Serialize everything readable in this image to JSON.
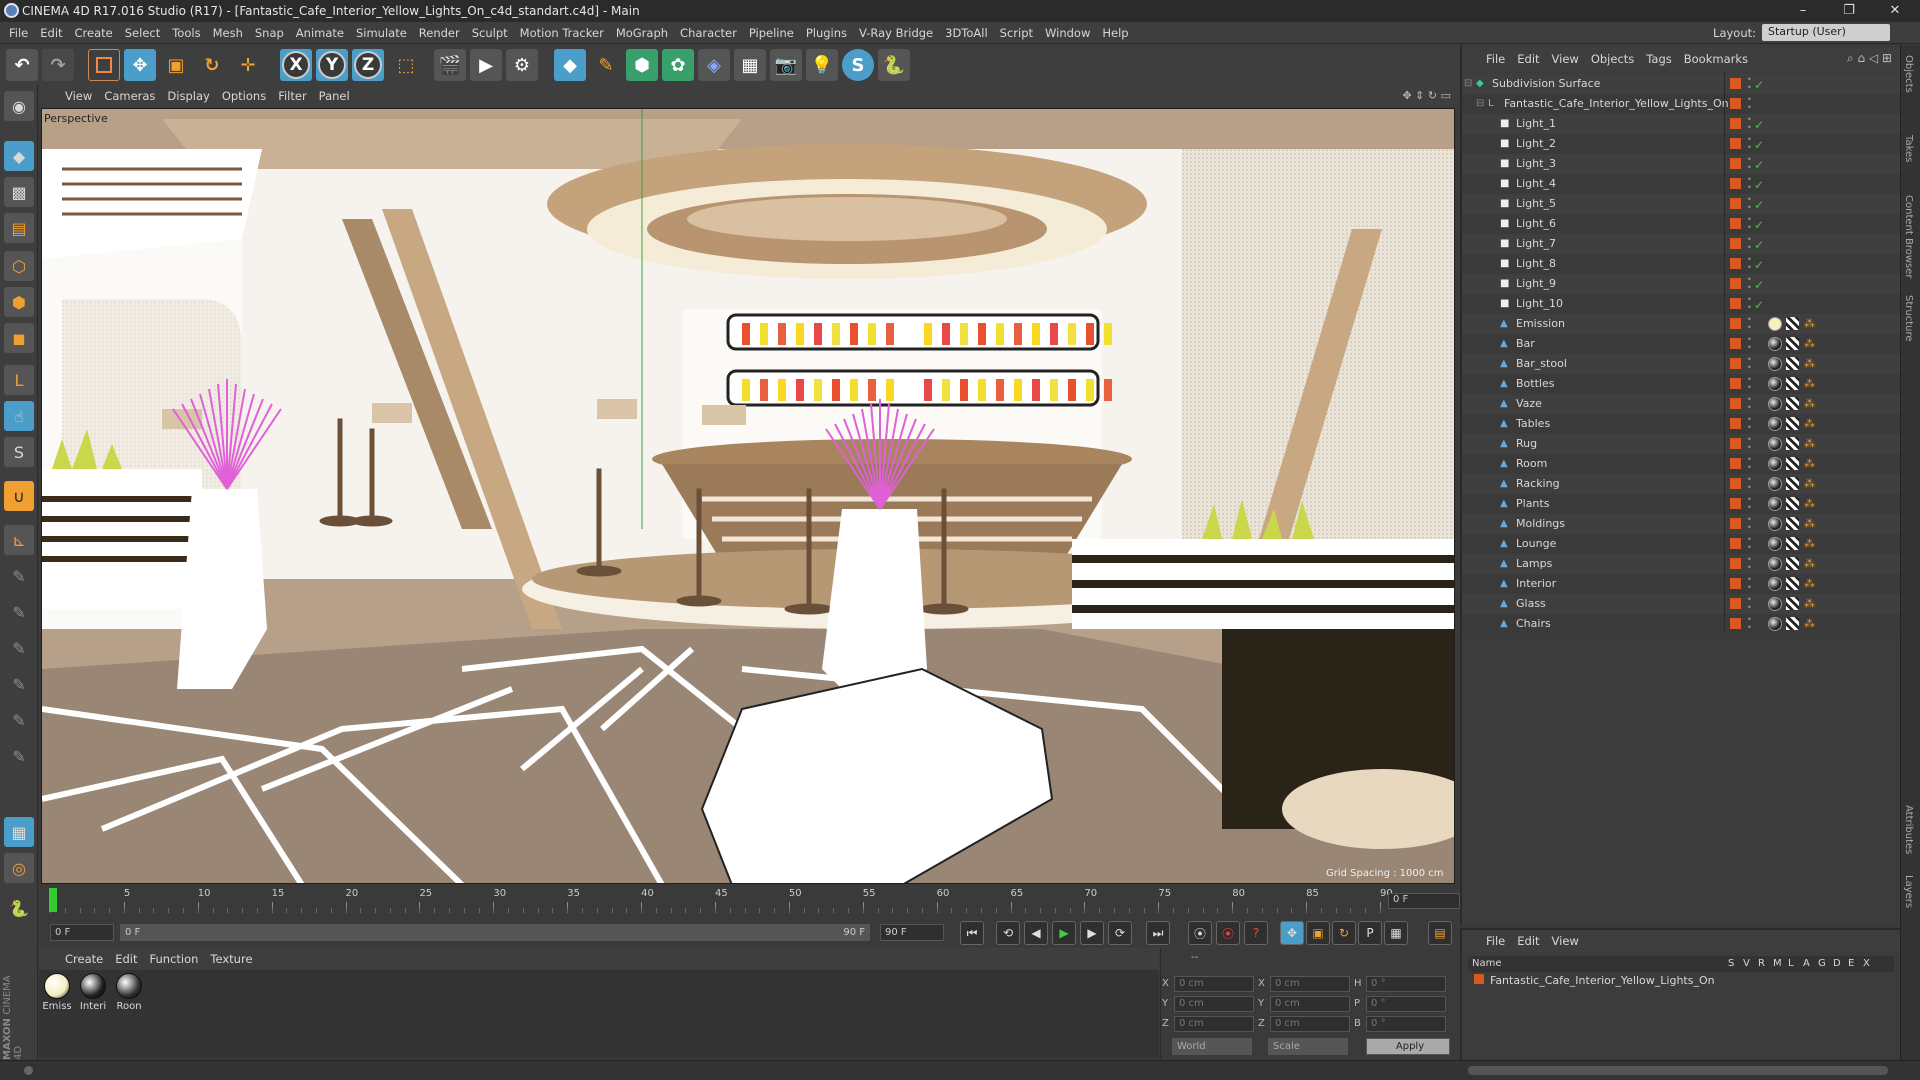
{
  "app": {
    "title": "CINEMA 4D R17.016 Studio (R17) - [Fantastic_Cafe_Interior_Yellow_Lights_On_c4d_standart.c4d] - Main",
    "minimize": "–",
    "maximize": "❐",
    "close": "✕"
  },
  "menu": [
    "File",
    "Edit",
    "Create",
    "Select",
    "Tools",
    "Mesh",
    "Snap",
    "Animate",
    "Simulate",
    "Render",
    "Sculpt",
    "Motion Tracker",
    "MoGraph",
    "Character",
    "Pipeline",
    "Plugins",
    "V-Ray Bridge",
    "3DToAll",
    "Script",
    "Window",
    "Help"
  ],
  "layout": {
    "label": "Layout:",
    "value": "Startup (User)"
  },
  "toolbar": {
    "axis_x": "X",
    "axis_y": "Y",
    "axis_z": "Z"
  },
  "viewport": {
    "menu": [
      "View",
      "Cameras",
      "Display",
      "Options",
      "Filter",
      "Panel"
    ],
    "label": "Perspective",
    "grid": "Grid Spacing : 1000 cm"
  },
  "timeline": {
    "ticks": [
      "0",
      "5",
      "10",
      "15",
      "20",
      "25",
      "30",
      "35",
      "40",
      "45",
      "50",
      "55",
      "60",
      "65",
      "70",
      "75",
      "80",
      "85",
      "90"
    ],
    "current": "0 F",
    "start": "0 F",
    "range_start": "0 F",
    "range_end": "90 F",
    "end": "90 F"
  },
  "materials": {
    "menu": [
      "Create",
      "Edit",
      "Function",
      "Texture"
    ],
    "items": [
      {
        "label": "Emiss",
        "color": "#f4ecc0"
      },
      {
        "label": "Interi",
        "color": "#222222"
      },
      {
        "label": "Roon",
        "color": "#333333"
      }
    ]
  },
  "coords": {
    "rows": [
      {
        "a": "X",
        "av": "0 cm",
        "b": "X",
        "bv": "0 cm",
        "c": "H",
        "cv": "0 °"
      },
      {
        "a": "Y",
        "av": "0 cm",
        "b": "Y",
        "bv": "0 cm",
        "c": "P",
        "cv": "0 °"
      },
      {
        "a": "Z",
        "av": "0 cm",
        "b": "Z",
        "bv": "0 cm",
        "c": "B",
        "cv": "0 °"
      }
    ],
    "mode1": "World",
    "mode2": "Scale",
    "apply": "Apply",
    "header": "--"
  },
  "objects": {
    "menu": [
      "File",
      "Edit",
      "View",
      "Objects",
      "Tags",
      "Bookmarks"
    ],
    "root1": "Subdivision Surface",
    "root2": "Fantastic_Cafe_Interior_Yellow_Lights_On",
    "lights": [
      "Light_1",
      "Light_2",
      "Light_3",
      "Light_4",
      "Light_5",
      "Light_6",
      "Light_7",
      "Light_8",
      "Light_9",
      "Light_10"
    ],
    "meshes": [
      "Emission",
      "Bar",
      "Bar_stool",
      "Bottles",
      "Vaze",
      "Tables",
      "Rug",
      "Room",
      "Racking",
      "Plants",
      "Moldings",
      "Lounge",
      "Lamps",
      "Interior",
      "Glass",
      "Chairs"
    ]
  },
  "layers": {
    "menu": [
      "File",
      "Edit",
      "View"
    ],
    "header_name": "Name",
    "cols": [
      "S",
      "V",
      "R",
      "M",
      "L",
      "A",
      "G",
      "D",
      "E",
      "X"
    ],
    "row": "Fantastic_Cafe_Interior_Yellow_Lights_On"
  },
  "side_tabs": [
    "Objects",
    "Takes",
    "Content Browser",
    "Structure",
    "Attributes",
    "Layers"
  ],
  "brand": {
    "maxon": "MAXON",
    "c4d": "CINEMA 4D"
  }
}
